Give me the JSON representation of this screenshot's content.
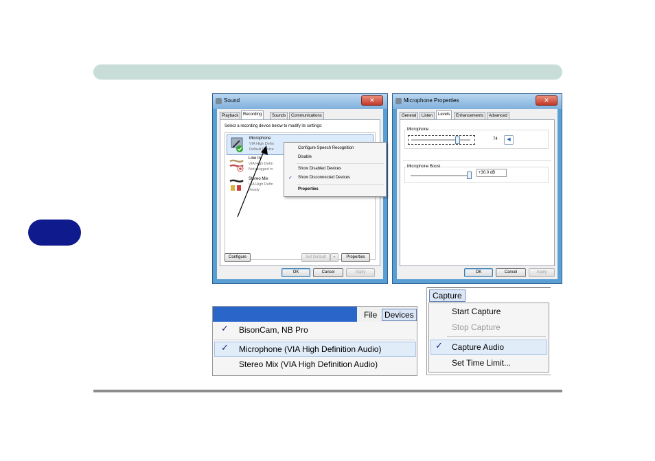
{
  "sound_dialog": {
    "title": "Sound",
    "tabs": [
      "Playback",
      "Recording",
      "Sounds",
      "Communications"
    ],
    "instruction": "Select a recording device below to modify its settings:",
    "devices": [
      {
        "name": "Microphone",
        "driver": "VIA High Defin",
        "status": "Default Device"
      },
      {
        "name": "Line In",
        "driver": "VIA High Defin",
        "status": "Not plugged in"
      },
      {
        "name": "Stereo Mix",
        "driver": "VIA High Defin",
        "status": "Ready"
      }
    ],
    "context_menu": {
      "items": [
        "Configure Speech Recognition",
        "Disable",
        "Show Disabled Devices",
        "Show Disconnected Devices",
        "Properties"
      ],
      "checked": "Show Disconnected Devices"
    },
    "buttons": {
      "configure": "Configure",
      "set_default": "Set Default",
      "properties": "Properties",
      "ok": "OK",
      "cancel": "Cancel",
      "apply": "Apply"
    }
  },
  "mic_properties": {
    "title": "Microphone Properties",
    "tabs": [
      "General",
      "Listen",
      "Levels",
      "Enhancements",
      "Advanced"
    ],
    "active_tab": "Levels",
    "microphone_label": "Microphone",
    "microphone_level": "74",
    "boost_label": "Microphone Boost",
    "boost_value": "+30.0 dB",
    "buttons": {
      "ok": "OK",
      "cancel": "Cancel",
      "apply": "Apply"
    }
  },
  "devices_menu": {
    "menubar": [
      "File",
      "Devices"
    ],
    "items": [
      {
        "label": "BisonCam, NB Pro",
        "checked": true
      },
      {
        "label": "Microphone (VIA High Definition Audio)",
        "checked": true
      },
      {
        "label": "Stereo Mix (VIA High Definition Audio)",
        "checked": false
      }
    ]
  },
  "capture_menu": {
    "menubar": "Capture",
    "items": [
      {
        "label": "Start Capture",
        "enabled": true,
        "checked": false
      },
      {
        "label": "Stop Capture",
        "enabled": false,
        "checked": false
      },
      {
        "label": "Capture Audio",
        "enabled": true,
        "checked": true
      },
      {
        "label": "Set Time Limit...",
        "enabled": true,
        "checked": false
      }
    ]
  },
  "check_glyph": "✓",
  "colors": {
    "header_bar": "#c8dcd8",
    "chapter_tab": "#0f1a8c",
    "window_frame": "#5a9fd4"
  }
}
